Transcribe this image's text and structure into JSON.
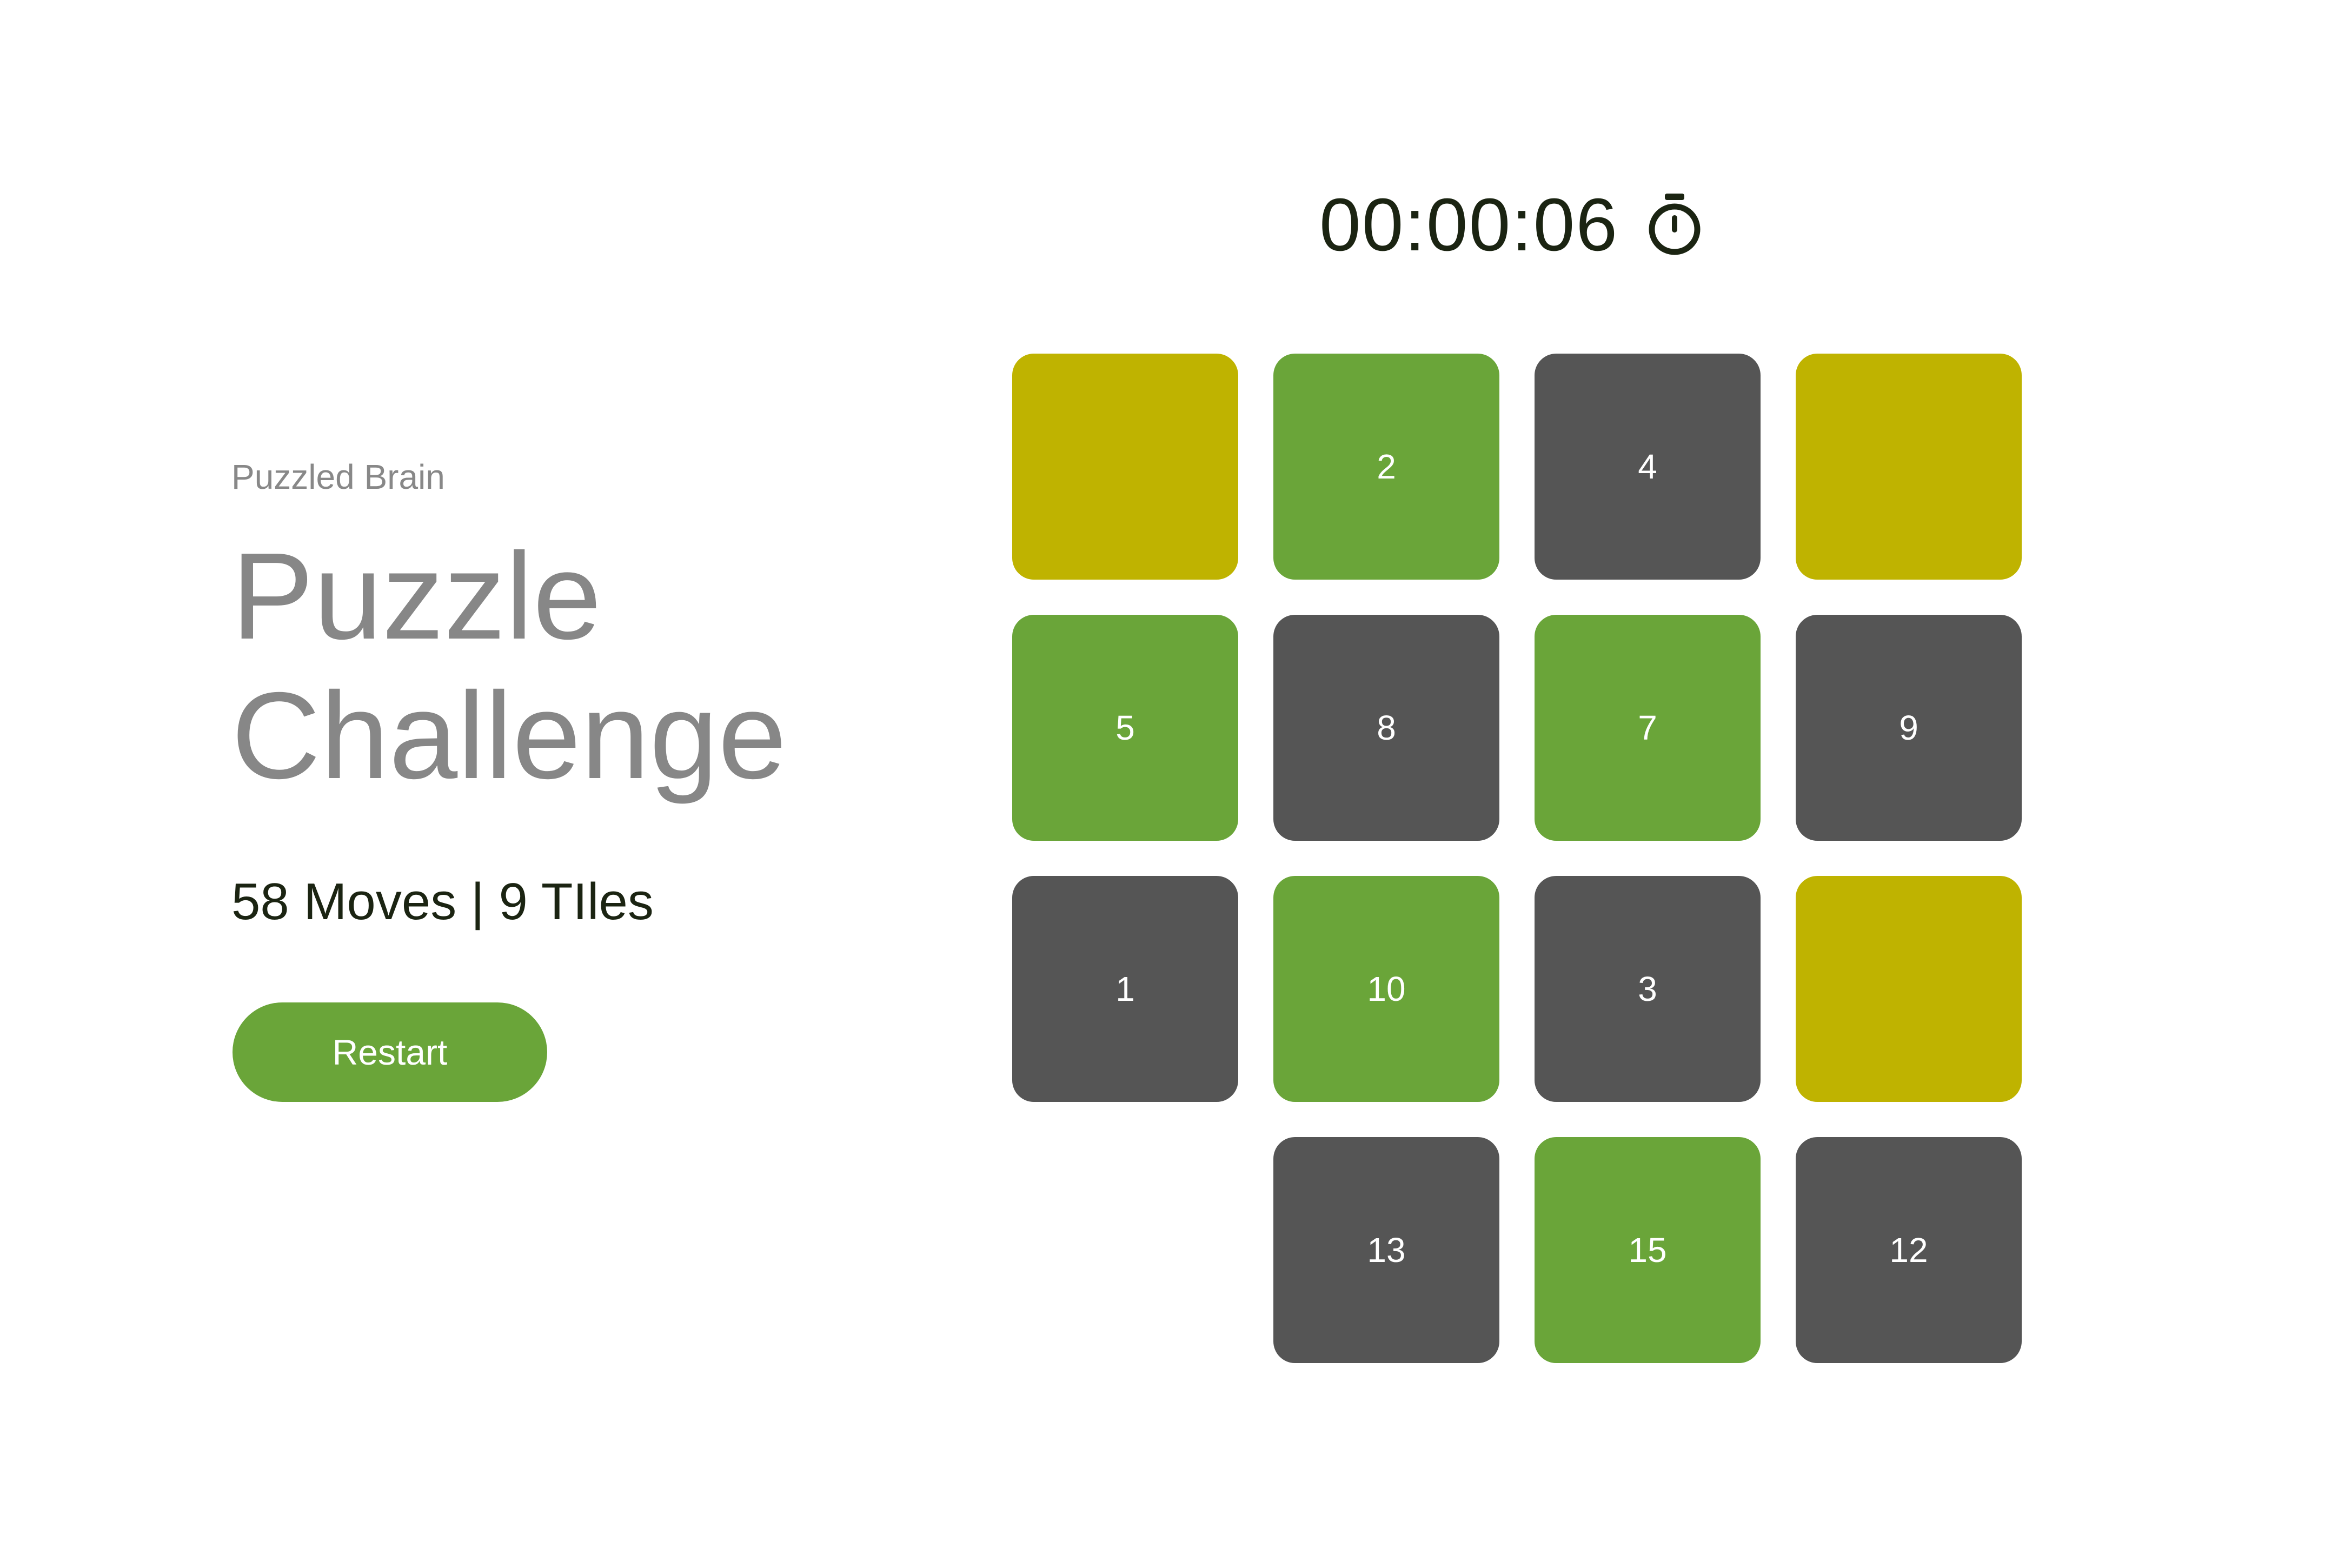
{
  "header": {
    "brand": "Puzzled Brain",
    "title_line1": "Puzzle",
    "title_line2": "Challenge"
  },
  "stats": {
    "text": "58 Moves | 9 TIles"
  },
  "restart_label": "Restart",
  "timer": {
    "value": "00:00:06",
    "icon": "stopwatch-icon"
  },
  "colors": {
    "green": "#6aa539",
    "dark": "#555555",
    "yellow": "#bfb300",
    "text_dark": "#1b2412",
    "text_gray": "#878787"
  },
  "board": {
    "rows": 4,
    "cols": 4,
    "tiles": [
      {
        "label": "",
        "color": "yellow"
      },
      {
        "label": "2",
        "color": "green"
      },
      {
        "label": "4",
        "color": "dark"
      },
      {
        "label": "",
        "color": "yellow"
      },
      {
        "label": "5",
        "color": "green"
      },
      {
        "label": "8",
        "color": "dark"
      },
      {
        "label": "7",
        "color": "green"
      },
      {
        "label": "9",
        "color": "dark"
      },
      {
        "label": "1",
        "color": "dark"
      },
      {
        "label": "10",
        "color": "green"
      },
      {
        "label": "3",
        "color": "dark"
      },
      {
        "label": "",
        "color": "yellow"
      },
      {
        "label": "",
        "color": "empty"
      },
      {
        "label": "13",
        "color": "dark"
      },
      {
        "label": "15",
        "color": "green"
      },
      {
        "label": "12",
        "color": "dark"
      }
    ]
  }
}
